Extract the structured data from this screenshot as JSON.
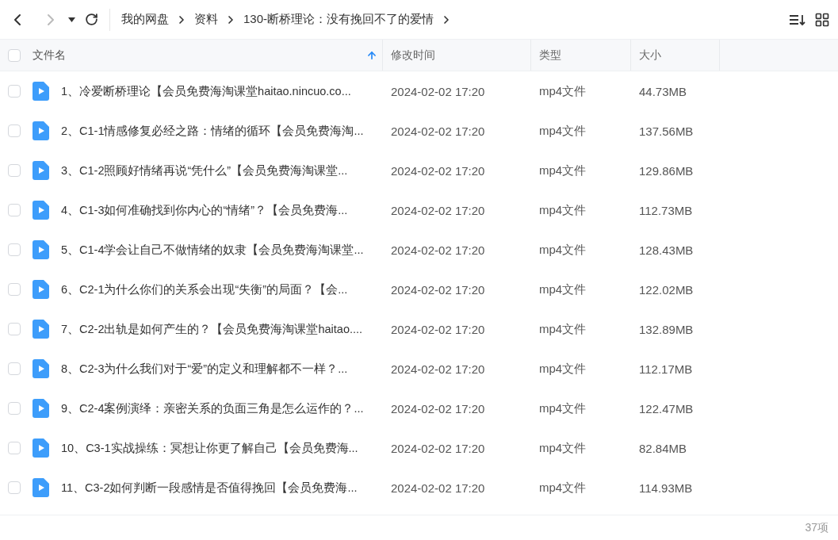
{
  "toolbar": {
    "back": {
      "disabled": false
    },
    "forward": {
      "disabled": true
    },
    "breadcrumb": [
      "我的网盘",
      "资料",
      "130-断桥理论：没有挽回不了的爱情"
    ]
  },
  "table": {
    "select_all": {
      "checked": false
    },
    "columns": [
      {
        "label": "文件名",
        "sorted": true
      },
      {
        "label": "修改时间",
        "sorted": false
      },
      {
        "label": "类型",
        "sorted": false
      },
      {
        "label": "大小",
        "sorted": false
      }
    ],
    "rows": [
      {
        "checked": false,
        "name": "1、冷爱断桥理论【会员免费海淘课堂haitao.nincuo.co...",
        "modified": "2024-02-02 17:20",
        "type": "mp4文件",
        "size": "44.73MB"
      },
      {
        "checked": false,
        "name": "2、C1-1情感修复必经之路：情绪的循环【会员免费海淘...",
        "modified": "2024-02-02 17:20",
        "type": "mp4文件",
        "size": "137.56MB"
      },
      {
        "checked": false,
        "name": "3、C1-2照顾好情绪再说“凭什么”【会员免费海淘课堂...",
        "modified": "2024-02-02 17:20",
        "type": "mp4文件",
        "size": "129.86MB"
      },
      {
        "checked": false,
        "name": "4、C1-3如何准确找到你内心的“情绪”？【会员免费海...",
        "modified": "2024-02-02 17:20",
        "type": "mp4文件",
        "size": "112.73MB"
      },
      {
        "checked": false,
        "name": "5、C1-4学会让自己不做情绪的奴隶【会员免费海淘课堂...",
        "modified": "2024-02-02 17:20",
        "type": "mp4文件",
        "size": "128.43MB"
      },
      {
        "checked": false,
        "name": "6、C2-1为什么你们的关系会出现“失衡”的局面？【会...",
        "modified": "2024-02-02 17:20",
        "type": "mp4文件",
        "size": "122.02MB"
      },
      {
        "checked": false,
        "name": "7、C2-2出轨是如何产生的？【会员免费海淘课堂haitao....",
        "modified": "2024-02-02 17:20",
        "type": "mp4文件",
        "size": "132.89MB"
      },
      {
        "checked": false,
        "name": "8、C2-3为什么我们对于“爱”的定义和理解都不一样？...",
        "modified": "2024-02-02 17:20",
        "type": "mp4文件",
        "size": "112.17MB"
      },
      {
        "checked": false,
        "name": "9、C2-4案例演绎：亲密关系的负面三角是怎么运作的？...",
        "modified": "2024-02-02 17:20",
        "type": "mp4文件",
        "size": "122.47MB"
      },
      {
        "checked": false,
        "name": "10、C3-1实战操练：冥想让你更了解自己【会员免费海...",
        "modified": "2024-02-02 17:20",
        "type": "mp4文件",
        "size": "82.84MB"
      },
      {
        "checked": false,
        "name": "11、C3-2如何判断一段感情是否值得挽回【会员免费海...",
        "modified": "2024-02-02 17:20",
        "type": "mp4文件",
        "size": "114.93MB"
      }
    ]
  },
  "footer": {
    "count": "37项"
  }
}
